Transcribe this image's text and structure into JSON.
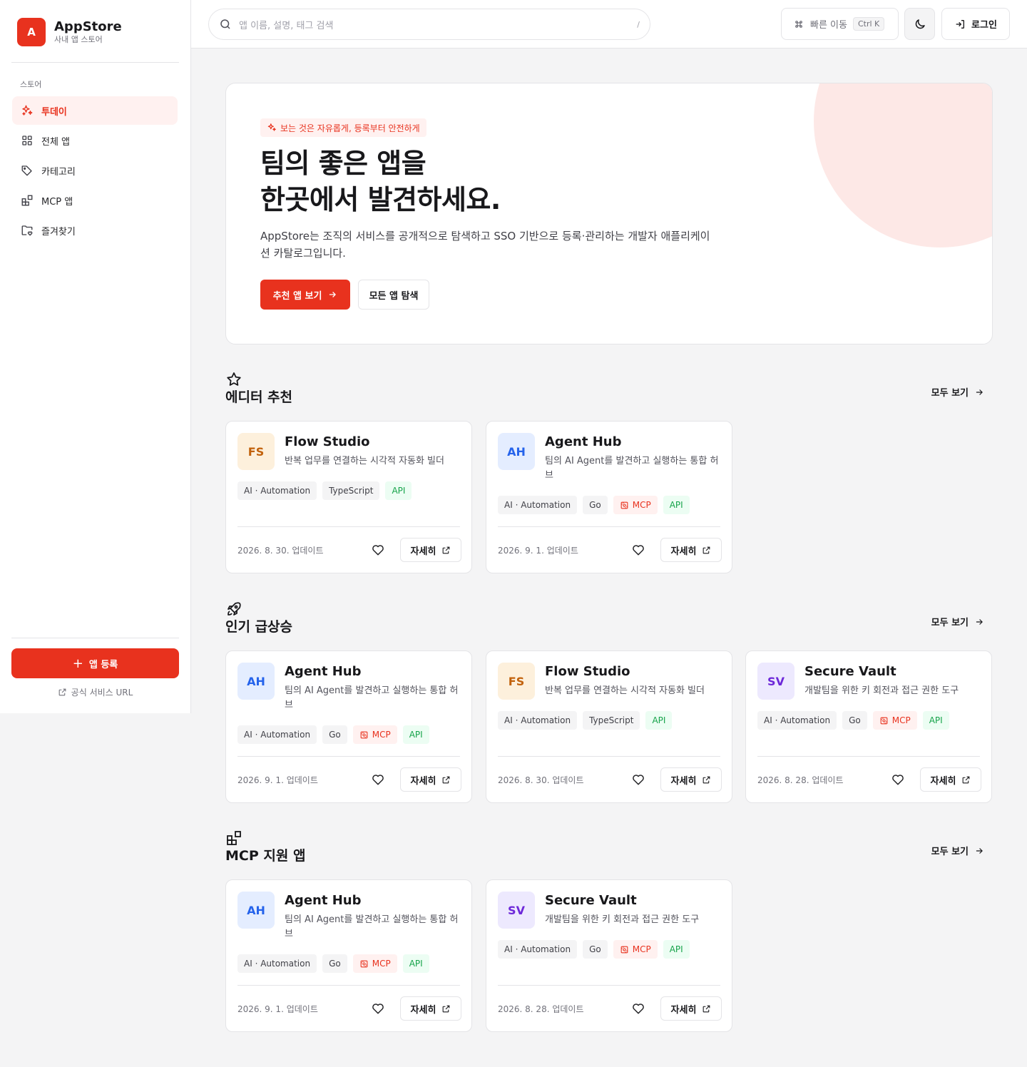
{
  "brand": {
    "logo_letter": "A",
    "name": "AppStore",
    "subtitle": "사내 앱 스토어"
  },
  "sidebar": {
    "section_label": "스토어",
    "items": [
      {
        "label": "투데이",
        "icon": "sparkles-icon",
        "active": true
      },
      {
        "label": "전체 앱",
        "icon": "grid-icon",
        "active": false
      },
      {
        "label": "카테고리",
        "icon": "tag-icon",
        "active": false
      },
      {
        "label": "MCP 앱",
        "icon": "blocks-icon",
        "active": false
      },
      {
        "label": "즐겨찾기",
        "icon": "folder-heart-icon",
        "active": false
      }
    ],
    "register_label": "앱 등록",
    "official_link_label": "공식 서비스 URL"
  },
  "topbar": {
    "search_placeholder": "앱 이름, 설명, 태그 검색",
    "search_shortcut": "/",
    "quick_label": "빠른 이동",
    "quick_kbd": "Ctrl K",
    "login_label": "로그인"
  },
  "hero": {
    "tag": "보는 것은 자유롭게, 등록부터 안전하게",
    "title_line1": "팀의 좋은 앱을",
    "title_line2": "한곳에서 발견하세요.",
    "description": "AppStore는 조직의 서비스를 공개적으로 탐색하고 SSO 기반으로 등록·관리하는 개발자 애플리케이션 카탈로그입니다.",
    "primary_button": "추천 앱 보기",
    "secondary_button": "모든 앱 탐색"
  },
  "view_all_label": "모두 보기",
  "detail_label": "자세히",
  "sections": [
    {
      "title": "에디터 추천",
      "icon": "star-icon",
      "cards": [
        {
          "initials": "FS",
          "name": "Flow Studio",
          "desc": "반복 업무를 연결하는 시각적 자동화 빌더",
          "tags": [
            "AI · Automation",
            "TypeScript",
            "API"
          ],
          "date": "2026. 8. 30. 업데이트"
        },
        {
          "initials": "AH",
          "name": "Agent Hub",
          "desc": "팀의 AI Agent를 발견하고 실행하는 통합 허브",
          "tags": [
            "AI · Automation",
            "Go",
            "MCP",
            "API"
          ],
          "date": "2026. 9. 1. 업데이트"
        }
      ]
    },
    {
      "title": "인기 급상승",
      "icon": "rocket-icon",
      "cards": [
        {
          "initials": "AH",
          "name": "Agent Hub",
          "desc": "팀의 AI Agent를 발견하고 실행하는 통합 허브",
          "tags": [
            "AI · Automation",
            "Go",
            "MCP",
            "API"
          ],
          "date": "2026. 9. 1. 업데이트"
        },
        {
          "initials": "FS",
          "name": "Flow Studio",
          "desc": "반복 업무를 연결하는 시각적 자동화 빌더",
          "tags": [
            "AI · Automation",
            "TypeScript",
            "API"
          ],
          "date": "2026. 8. 30. 업데이트"
        },
        {
          "initials": "SV",
          "name": "Secure Vault",
          "desc": "개발팀을 위한 키 회전과 접근 권한 도구",
          "tags": [
            "AI · Automation",
            "Go",
            "MCP",
            "API"
          ],
          "date": "2026. 8. 28. 업데이트"
        }
      ]
    },
    {
      "title": "MCP 지원 앱",
      "icon": "blocks-icon",
      "cards": [
        {
          "initials": "AH",
          "name": "Agent Hub",
          "desc": "팀의 AI Agent를 발견하고 실행하는 통합 허브",
          "tags": [
            "AI · Automation",
            "Go",
            "MCP",
            "API"
          ],
          "date": "2026. 9. 1. 업데이트"
        },
        {
          "initials": "SV",
          "name": "Secure Vault",
          "desc": "개발팀을 위한 키 회전과 접근 권한 도구",
          "tags": [
            "AI · Automation",
            "Go",
            "MCP",
            "API"
          ],
          "date": "2026. 8. 28. 업데이트"
        }
      ]
    }
  ],
  "colors": {
    "accent": "#e8321e",
    "avatar_FS_bg": "#fdf0dc",
    "avatar_FS_fg": "#c2620c",
    "avatar_AH_bg": "#e4edff",
    "avatar_AH_fg": "#2563eb",
    "avatar_SV_bg": "#ede9fe",
    "avatar_SV_fg": "#6d28d9"
  }
}
